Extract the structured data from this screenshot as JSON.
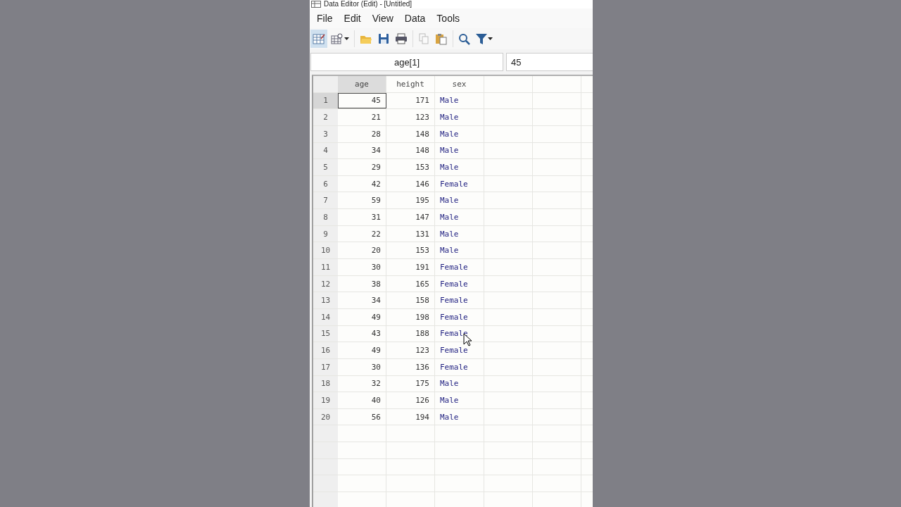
{
  "window": {
    "title": "Data Editor (Edit) - [Untitled]"
  },
  "menu": [
    "File",
    "Edit",
    "View",
    "Data",
    "Tools"
  ],
  "toolbar": [
    {
      "kind": "edit",
      "selected": true,
      "disabled": false
    },
    {
      "kind": "browse",
      "selected": false,
      "disabled": false
    },
    {
      "kind": "open",
      "selected": false,
      "disabled": false
    },
    {
      "kind": "save",
      "selected": false,
      "disabled": false
    },
    {
      "kind": "print",
      "selected": false,
      "disabled": false
    },
    {
      "kind": "copy",
      "selected": false,
      "disabled": true
    },
    {
      "kind": "paste",
      "selected": false,
      "disabled": false
    },
    {
      "kind": "search",
      "selected": false,
      "disabled": false
    },
    {
      "kind": "filter",
      "selected": false,
      "disabled": false
    }
  ],
  "cell_name": "age[1]",
  "cell_value": "45",
  "table": {
    "columns": [
      {
        "name": "age",
        "selected": true,
        "kind": "numeric"
      },
      {
        "name": "height",
        "selected": false,
        "kind": "numeric"
      },
      {
        "name": "sex",
        "selected": false,
        "kind": "string"
      }
    ],
    "rows": [
      {
        "number": "1",
        "selected": true,
        "cells": [
          "45",
          "171",
          "Male"
        ]
      },
      {
        "number": "2",
        "selected": false,
        "cells": [
          "21",
          "123",
          "Male"
        ]
      },
      {
        "number": "3",
        "selected": false,
        "cells": [
          "28",
          "148",
          "Male"
        ]
      },
      {
        "number": "4",
        "selected": false,
        "cells": [
          "34",
          "148",
          "Male"
        ]
      },
      {
        "number": "5",
        "selected": false,
        "cells": [
          "29",
          "153",
          "Male"
        ]
      },
      {
        "number": "6",
        "selected": false,
        "cells": [
          "42",
          "146",
          "Female"
        ]
      },
      {
        "number": "7",
        "selected": false,
        "cells": [
          "59",
          "195",
          "Male"
        ]
      },
      {
        "number": "8",
        "selected": false,
        "cells": [
          "31",
          "147",
          "Male"
        ]
      },
      {
        "number": "9",
        "selected": false,
        "cells": [
          "22",
          "131",
          "Male"
        ]
      },
      {
        "number": "10",
        "selected": false,
        "cells": [
          "20",
          "153",
          "Male"
        ]
      },
      {
        "number": "11",
        "selected": false,
        "cells": [
          "30",
          "191",
          "Female"
        ]
      },
      {
        "number": "12",
        "selected": false,
        "cells": [
          "38",
          "165",
          "Female"
        ]
      },
      {
        "number": "13",
        "selected": false,
        "cells": [
          "34",
          "158",
          "Female"
        ]
      },
      {
        "number": "14",
        "selected": false,
        "cells": [
          "49",
          "198",
          "Female"
        ]
      },
      {
        "number": "15",
        "selected": false,
        "cells": [
          "43",
          "188",
          "Female"
        ]
      },
      {
        "number": "16",
        "selected": false,
        "cells": [
          "49",
          "123",
          "Female"
        ]
      },
      {
        "number": "17",
        "selected": false,
        "cells": [
          "30",
          "136",
          "Female"
        ]
      },
      {
        "number": "18",
        "selected": false,
        "cells": [
          "32",
          "175",
          "Male"
        ]
      },
      {
        "number": "19",
        "selected": false,
        "cells": [
          "40",
          "126",
          "Male"
        ]
      },
      {
        "number": "20",
        "selected": false,
        "cells": [
          "56",
          "194",
          "Male"
        ]
      }
    ]
  }
}
